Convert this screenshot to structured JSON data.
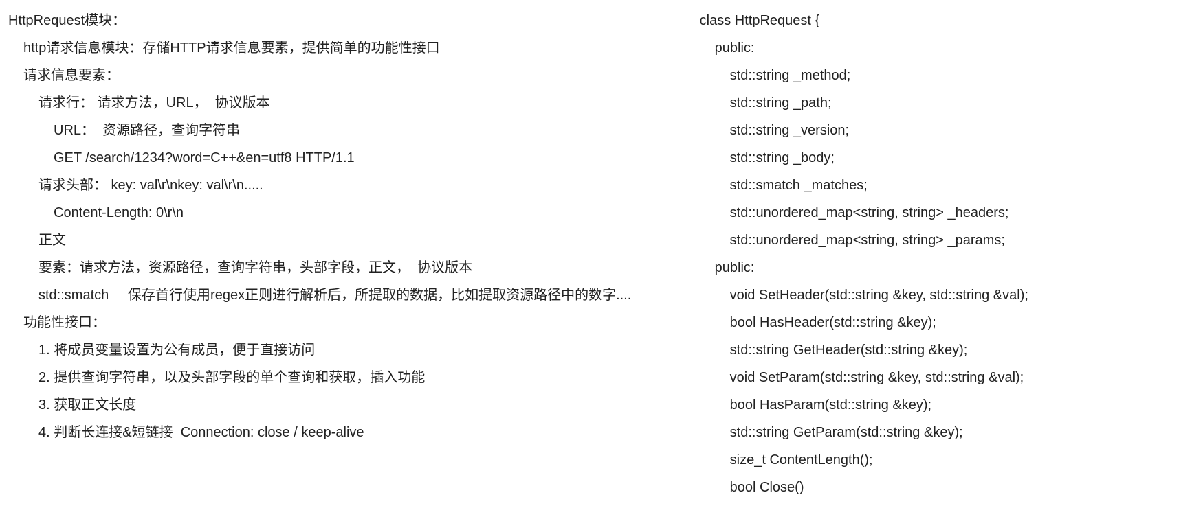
{
  "left": {
    "l0": "HttpRequest模块：",
    "l1": "http请求信息模块：存储HTTP请求信息要素，提供简单的功能性接口",
    "l2": "请求信息要素：",
    "l3": "请求行： 请求方法，URL，  协议版本",
    "l4": "URL：  资源路径，查询字符串",
    "l5": "GET /search/1234?word=C++&en=utf8 HTTP/1.1",
    "l6": "请求头部： key: val\\r\\nkey: val\\r\\n.....",
    "l7": "Content-Length: 0\\r\\n",
    "l8": "正文",
    "l9": "要素：请求方法，资源路径，查询字符串，头部字段，正文，  协议版本",
    "l10": "std::smatch     保存首行使用regex正则进行解析后，所提取的数据，比如提取资源路径中的数字....",
    "l11": "功能性接口：",
    "l12": "1. 将成员变量设置为公有成员，便于直接访问",
    "l13": "2. 提供查询字符串，以及头部字段的单个查询和获取，插入功能",
    "l14": "3. 获取正文长度",
    "l15": "4. 判断长连接&短链接  Connection: close / keep-alive"
  },
  "right": {
    "r0": "class HttpRequest {",
    "r1": "public:",
    "r2": "std::string _method;",
    "r3": "std::string _path;",
    "r4": "std::string _version;",
    "r5": "std::string _body;",
    "r6": "std::smatch _matches;",
    "r7": "std::unordered_map<string, string> _headers;",
    "r8": "std::unordered_map<string, string> _params;",
    "r9": "public:",
    "r10": "void SetHeader(std::string &key, std::string &val);",
    "r11": "bool HasHeader(std::string &key);",
    "r12": "std::string GetHeader(std::string &key);",
    "r13": "void SetParam(std::string &key, std::string &val);",
    "r14": "bool HasParam(std::string &key);",
    "r15": "std::string GetParam(std::string &key);",
    "r16": "size_t ContentLength();",
    "r17": "bool Close()"
  }
}
